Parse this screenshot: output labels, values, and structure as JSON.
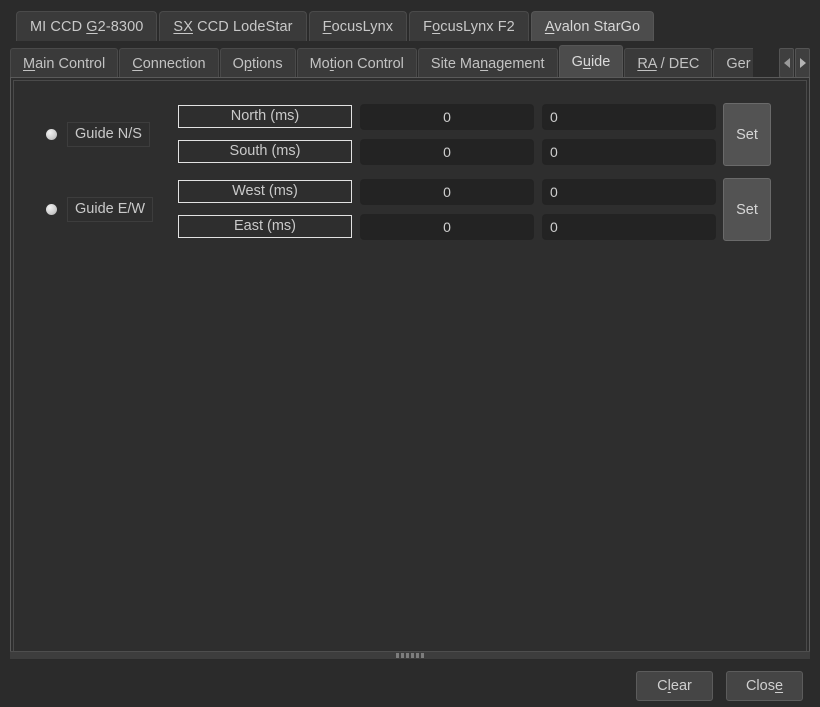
{
  "device_tabs": [
    {
      "label": "MI CCD G2-8300",
      "mnemonic": "G",
      "active": false
    },
    {
      "label": "SX CCD LodeStar",
      "mnemonic": "SX",
      "active": false
    },
    {
      "label": "FocusLynx",
      "mnemonic": "F",
      "active": false
    },
    {
      "label": "FocusLynx F2",
      "mnemonic": "o",
      "active": false
    },
    {
      "label": "Avalon StarGo",
      "mnemonic": "A",
      "active": true
    }
  ],
  "page_tabs": [
    {
      "label": "Main Control",
      "mnemonic": "M",
      "active": false
    },
    {
      "label": "Connection",
      "mnemonic": "C",
      "active": false
    },
    {
      "label": "Options",
      "mnemonic": "p",
      "active": false
    },
    {
      "label": "Motion Control",
      "mnemonic": "t",
      "active": false
    },
    {
      "label": "Site Management",
      "mnemonic": "n",
      "active": false
    },
    {
      "label": "Guide",
      "mnemonic": "u",
      "active": true
    },
    {
      "label": "RA / DEC",
      "mnemonic": "RA",
      "active": false
    },
    {
      "label": "Ger",
      "mnemonic": "",
      "active": false,
      "clipped": true
    }
  ],
  "tab_scroll": {
    "left_icon": "triangle-left-icon",
    "right_icon": "triangle-right-icon"
  },
  "guide": {
    "groups": [
      {
        "name": "Guide N/S",
        "selected": true,
        "set_label": "Set",
        "rows": [
          {
            "direction": "North (ms)",
            "value": "0",
            "secondary": "0"
          },
          {
            "direction": "South (ms)",
            "value": "0",
            "secondary": "0"
          }
        ]
      },
      {
        "name": "Guide E/W",
        "selected": true,
        "set_label": "Set",
        "rows": [
          {
            "direction": "West (ms)",
            "value": "0",
            "secondary": "0"
          },
          {
            "direction": "East (ms)",
            "value": "0",
            "secondary": "0"
          }
        ]
      }
    ]
  },
  "footer": {
    "clear_label": "Clear",
    "clear_mnemonic": "l",
    "close_label": "Close",
    "close_mnemonic": "e"
  },
  "colors": {
    "window_bg": "#2b2b2b",
    "panel_bg": "#2e2e2e",
    "tab_bg": "#3a3a3a",
    "tab_active_bg": "#4c4c4c",
    "field_bg": "#232323",
    "button_bg": "#454545",
    "set_button_bg": "#535353",
    "text": "#c9c9c9",
    "border_light": "#e2e2e2"
  }
}
